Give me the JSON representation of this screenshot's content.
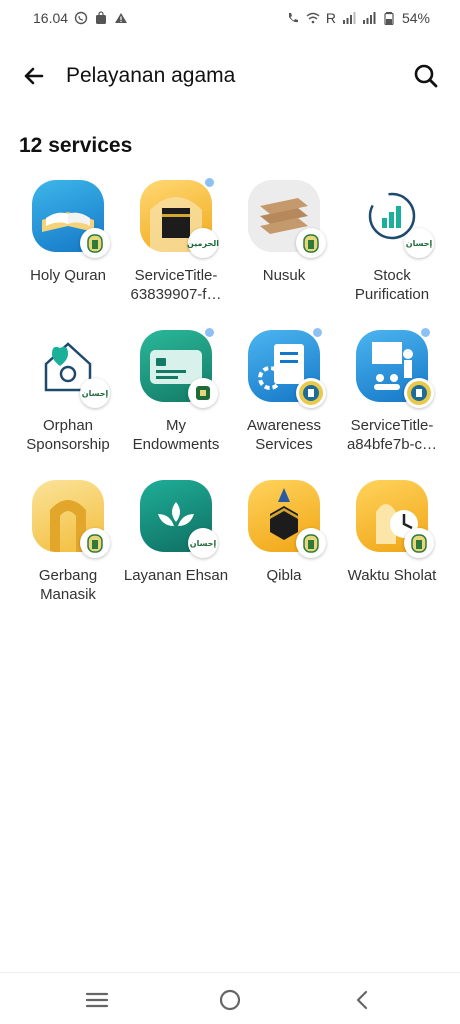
{
  "status_bar": {
    "time": "16.04",
    "carrier_r": "R",
    "battery": "54%",
    "icons": [
      "whatsapp-icon",
      "bag-icon",
      "alert-icon",
      "wifi-call-icon",
      "wifi-icon",
      "signal-icon",
      "signal-icon",
      "battery-icon"
    ]
  },
  "header": {
    "title": "Pelayanan agama",
    "back_icon": "arrow-left-icon",
    "search_icon": "search-icon"
  },
  "section": {
    "count_label": "12 services"
  },
  "services": [
    {
      "label": "Holy Quran",
      "icon": "quran-icon",
      "color": "#1e9fd8"
    },
    {
      "label": "ServiceTitle-63839907-f…",
      "icon": "kaaba-gate-icon",
      "color": "#f2b21a",
      "badge": "الحرمين"
    },
    {
      "label": "Nusuk",
      "icon": "books-icon",
      "color": "#ececec"
    },
    {
      "label": "Stock Purification",
      "icon": "chart-growth-icon",
      "color": "#ffffff",
      "badge": "إحسان"
    },
    {
      "label": "Orphan Sponsorship",
      "icon": "heart-house-icon",
      "color": "#ffffff",
      "badge": "إحسان"
    },
    {
      "label": "My Endowments",
      "icon": "card-icon",
      "color": "#1a9a7a"
    },
    {
      "label": "Awareness Services",
      "icon": "clipboard-gear-icon",
      "color": "#1e8fd8"
    },
    {
      "label": "ServiceTitle-a84bfe7b-c…",
      "icon": "presentation-icon",
      "color": "#1e8fd8"
    },
    {
      "label": "Gerbang Manasik",
      "icon": "gate-icon",
      "color": "#f5c542"
    },
    {
      "label": "Layanan Ehsan",
      "icon": "ehsan-icon",
      "color": "#158a7c",
      "badge": "إحسان"
    },
    {
      "label": "Qibla",
      "icon": "kaaba-compass-icon",
      "color": "#f5b520"
    },
    {
      "label": "Waktu Sholat",
      "icon": "mosque-clock-icon",
      "color": "#f5b520"
    }
  ],
  "nav_bar": {
    "items": [
      "menu-icon",
      "home-icon",
      "back-icon"
    ]
  }
}
